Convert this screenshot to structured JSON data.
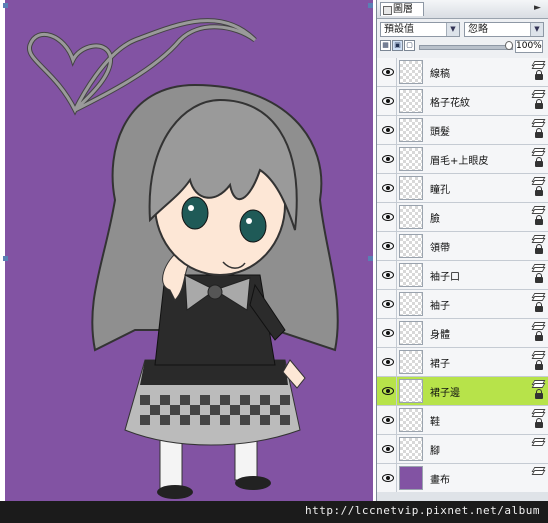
{
  "panel": {
    "title": "圖層",
    "menu_icon": "menu-arrow-icon",
    "preset_select": "預設值",
    "blend_select": "忽略",
    "opacity": "100%"
  },
  "layers": [
    {
      "name": "線稿",
      "visible": true,
      "active": false
    },
    {
      "name": "格子花紋",
      "visible": true,
      "active": false
    },
    {
      "name": "頭髮",
      "visible": true,
      "active": false
    },
    {
      "name": "眉毛+上眼皮",
      "visible": true,
      "active": false
    },
    {
      "name": "瞳孔",
      "visible": true,
      "active": false
    },
    {
      "name": "臉",
      "visible": true,
      "active": false
    },
    {
      "name": "領帶",
      "visible": true,
      "active": false
    },
    {
      "name": "袖子口",
      "visible": true,
      "active": false
    },
    {
      "name": "袖子",
      "visible": true,
      "active": false
    },
    {
      "name": "身體",
      "visible": true,
      "active": false
    },
    {
      "name": "裙子",
      "visible": true,
      "active": false
    },
    {
      "name": "裙子邊",
      "visible": true,
      "active": true
    },
    {
      "name": "鞋",
      "visible": true,
      "active": false
    },
    {
      "name": "腳",
      "visible": true,
      "active": false
    },
    {
      "name": "畫布",
      "visible": true,
      "active": false
    }
  ],
  "watermark": "http://lccnetvip.pixnet.net/album",
  "colors": {
    "canvas_background": "#8253a3",
    "active_layer": "#b7e34a",
    "hair": "#9a9a9a",
    "eyes": "#1f5a57"
  }
}
